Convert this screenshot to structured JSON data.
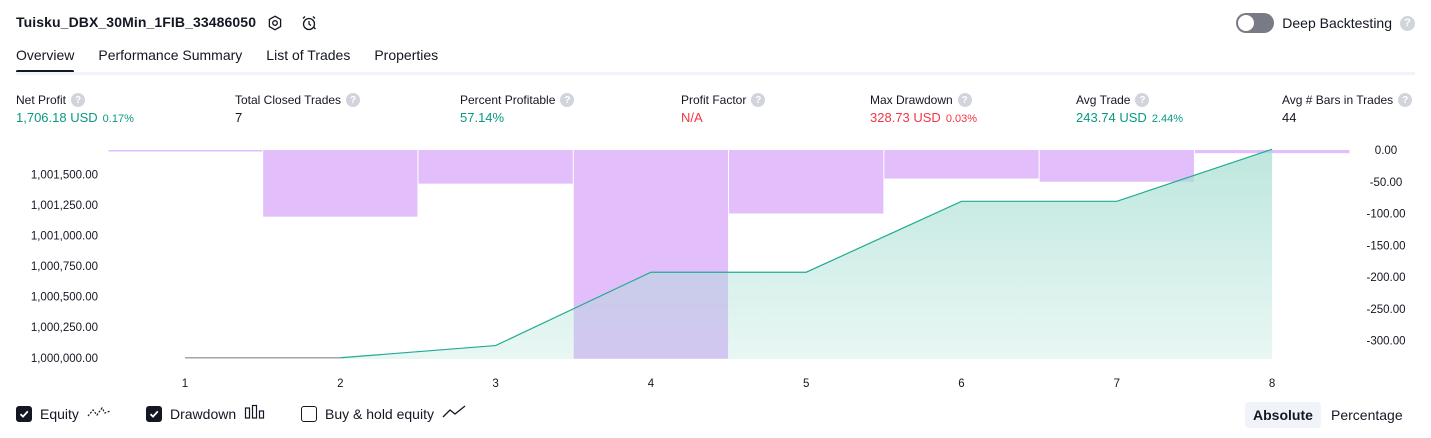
{
  "header": {
    "strategy_name": "Tuisku_DBX_30Min_1FIB_33486050",
    "settings_icon": "settings-icon",
    "alert_icon": "alarm-clock-icon",
    "deep_backtesting_label": "Deep Backtesting",
    "deep_backtesting_enabled": false,
    "help_glyph": "?"
  },
  "tabs": [
    {
      "label": "Overview",
      "active": true
    },
    {
      "label": "Performance Summary",
      "active": false
    },
    {
      "label": "List of Trades",
      "active": false
    },
    {
      "label": "Properties",
      "active": false
    }
  ],
  "stats": [
    {
      "label": "Net Profit",
      "value": "1,706.18 USD",
      "pct": "0.17%",
      "tone": "pos"
    },
    {
      "label": "Total Closed Trades",
      "value": "7",
      "pct": "",
      "tone": "neu"
    },
    {
      "label": "Percent Profitable",
      "value": "57.14%",
      "pct": "",
      "tone": "pos"
    },
    {
      "label": "Profit Factor",
      "value": "N/A",
      "pct": "",
      "tone": "neg"
    },
    {
      "label": "Max Drawdown",
      "value": "328.73 USD",
      "pct": "0.03%",
      "tone": "neg"
    },
    {
      "label": "Avg Trade",
      "value": "243.74 USD",
      "pct": "2.44%",
      "tone": "pos"
    },
    {
      "label": "Avg # Bars in Trades",
      "value": "44",
      "pct": "",
      "tone": "neu"
    }
  ],
  "chart_data": {
    "type": "line",
    "x": [
      1,
      2,
      3,
      4,
      5,
      6,
      7,
      8
    ],
    "equity": [
      1000000.0,
      1000000.0,
      1000100.0,
      1000700.0,
      1000700.0,
      1001280.0,
      1001280.0,
      1001706.18
    ],
    "drawdown_trades": [
      2,
      3,
      4,
      5,
      6,
      7,
      8
    ],
    "drawdown": [
      -2,
      -105,
      -53,
      -328.73,
      -100,
      -45,
      -50,
      -5
    ],
    "left_axis": {
      "ticks": [
        "1,000,000.00",
        "1,000,250.00",
        "1,000,500.00",
        "1,000,750.00",
        "1,001,000.00",
        "1,001,250.00",
        "1,001,500.00"
      ],
      "range": [
        999990,
        1001700
      ]
    },
    "right_axis": {
      "ticks": [
        "0.00",
        "-50.00",
        "-100.00",
        "-150.00",
        "-200.00",
        "-250.00",
        "-300.00"
      ],
      "range": [
        0,
        -330
      ]
    },
    "x_ticks": [
      "1",
      "2",
      "3",
      "4",
      "5",
      "6",
      "7",
      "8"
    ],
    "colors": {
      "equity_line": "#22ab94",
      "equity_fill": "#a8dfd3",
      "drawdown": "#ce93f8",
      "flat_line": "#9598a1"
    }
  },
  "legend": [
    {
      "label": "Equity",
      "checked": true,
      "icon": "equity-line-icon"
    },
    {
      "label": "Drawdown",
      "checked": true,
      "icon": "drawdown-bars-icon"
    },
    {
      "label": "Buy & hold equity",
      "checked": false,
      "icon": "buy-hold-line-icon"
    }
  ],
  "modes": [
    {
      "label": "Absolute",
      "active": true
    },
    {
      "label": "Percentage",
      "active": false
    }
  ]
}
